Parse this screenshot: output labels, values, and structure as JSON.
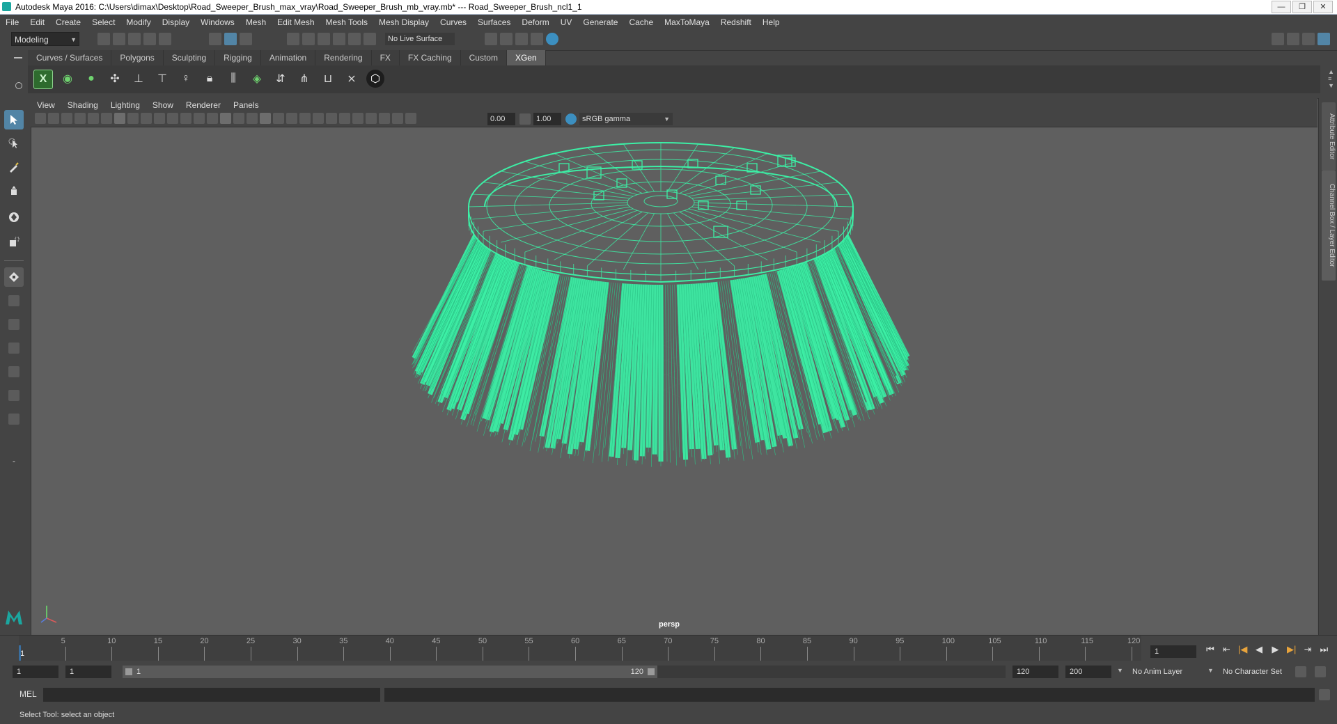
{
  "window": {
    "title": "Autodesk Maya 2016: C:\\Users\\dimax\\Desktop\\Road_Sweeper_Brush_max_vray\\Road_Sweeper_Brush_mb_vray.mb*   ---   Road_Sweeper_Brush_ncl1_1",
    "minimize": "—",
    "maximize": "❐",
    "close": "✕"
  },
  "menu": [
    "File",
    "Edit",
    "Create",
    "Select",
    "Modify",
    "Display",
    "Windows",
    "Mesh",
    "Edit Mesh",
    "Mesh Tools",
    "Mesh Display",
    "Curves",
    "Surfaces",
    "Deform",
    "UV",
    "Generate",
    "Cache",
    "MaxToMaya",
    "Redshift",
    "Help"
  ],
  "status_line": {
    "mode": "Modeling",
    "live_surface": "No Live Surface"
  },
  "shelf_tabs": [
    "Curves / Surfaces",
    "Polygons",
    "Sculpting",
    "Rigging",
    "Animation",
    "Rendering",
    "FX",
    "FX Caching",
    "Custom",
    "XGen"
  ],
  "shelf_active": "XGen",
  "viewport": {
    "menu": [
      "View",
      "Shading",
      "Lighting",
      "Show",
      "Renderer",
      "Panels"
    ],
    "exposure": "0.00",
    "gamma": "1.00",
    "color_space": "sRGB gamma",
    "camera_label": "persp"
  },
  "right_tabs": [
    "Attribute Editor",
    "Channel Box / Layer Editor"
  ],
  "time_slider": {
    "ticks": [
      "5",
      "10",
      "15",
      "20",
      "25",
      "30",
      "35",
      "40",
      "45",
      "50",
      "55",
      "60",
      "65",
      "70",
      "75",
      "80",
      "85",
      "90",
      "95",
      "100",
      "105",
      "110",
      "115",
      "120"
    ],
    "start_tick": "1",
    "current_frame": "1"
  },
  "range": {
    "start": "1",
    "playback_start": "1",
    "slider_start": "1",
    "slider_end": "120",
    "playback_end": "120",
    "end": "200",
    "anim_layer": "No Anim Layer",
    "character_set": "No Character Set"
  },
  "command_line": {
    "label": "MEL"
  },
  "help_line": "Select Tool: select an object",
  "colors": {
    "wireframe": "#3cf0a6",
    "viewport_bg": "#5f5f5f",
    "accent": "#5285a6"
  }
}
